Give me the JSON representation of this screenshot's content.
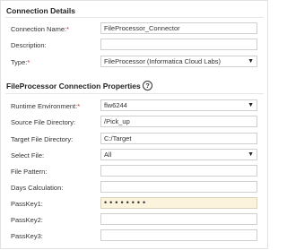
{
  "connection_details": {
    "title": "Connection Details",
    "connection_name": {
      "label": "Connection Name:",
      "required": "*",
      "value": "FileProcessor_Connector"
    },
    "description": {
      "label": "Description:",
      "value": ""
    },
    "type": {
      "label": "Type:",
      "required": "*",
      "selected": "FileProcessor (Informatica Cloud Labs)"
    }
  },
  "properties": {
    "title": "FileProcessor Connection Properties",
    "help_glyph": "?",
    "runtime_environment": {
      "label": "Runtime Environment:",
      "required": "*",
      "selected": "flw6244"
    },
    "source_dir": {
      "label": "Source File Directory:",
      "value": "/Pick_up"
    },
    "target_dir": {
      "label": "Target File Directory:",
      "value": "C:/Target"
    },
    "select_file": {
      "label": "Select File:",
      "selected": "All"
    },
    "file_pattern": {
      "label": "File Pattern:",
      "value": ""
    },
    "days_calculation": {
      "label": "Days Calculation:",
      "value": ""
    },
    "passkey1": {
      "label": "PassKey1:",
      "value": "••••••••"
    },
    "passkey2": {
      "label": "PassKey2:",
      "value": ""
    },
    "passkey3": {
      "label": "PassKey3:",
      "value": ""
    }
  },
  "icons": {
    "dropdown": "chevron-down-icon",
    "help": "question-circle-icon"
  },
  "colors": {
    "required": "#d9262b",
    "highlight": "#fbf3dc",
    "border": "#cfcfcf"
  }
}
